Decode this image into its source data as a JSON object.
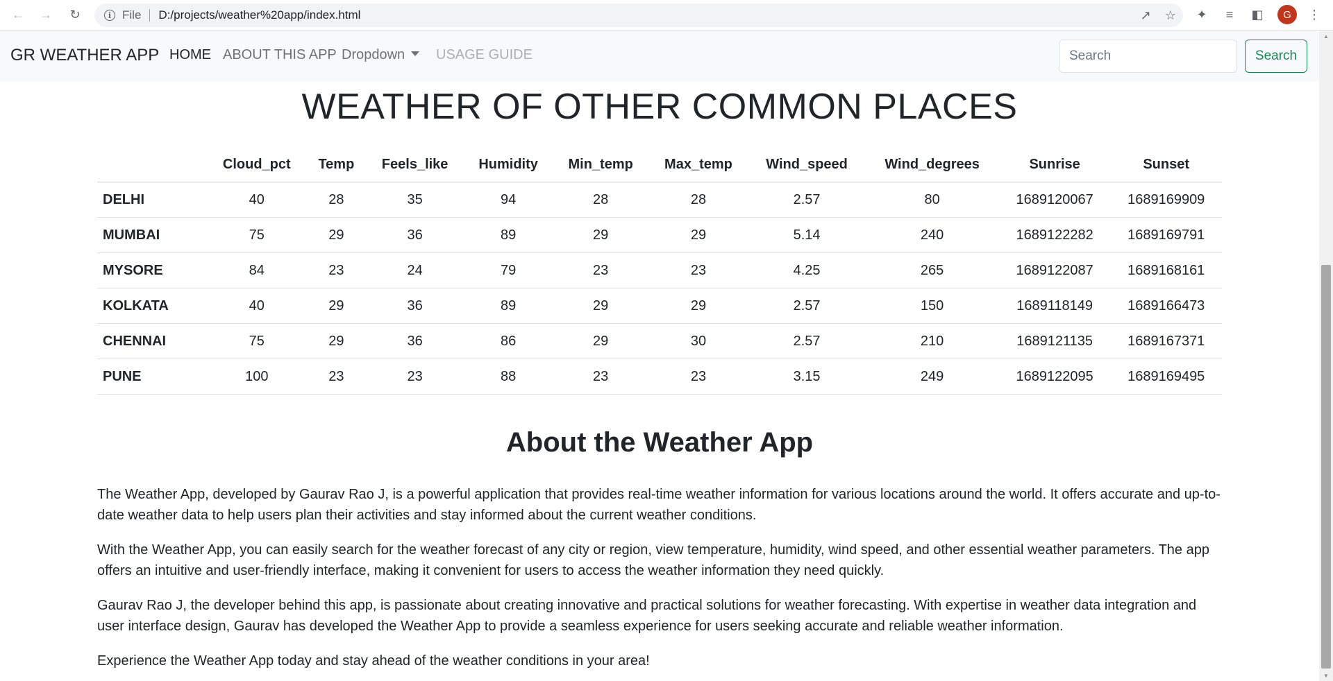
{
  "browser": {
    "scheme": "File",
    "url": "D:/projects/weather%20app/index.html",
    "profile_initial": "G",
    "profile_color": "#c1361b"
  },
  "navbar": {
    "brand": "GR WEATHER APP",
    "links": [
      "HOME",
      "ABOUT THIS APP",
      "Dropdown",
      "USAGE GUIDE"
    ],
    "search_placeholder": "Search",
    "search_button": "Search",
    "accent": "#198754"
  },
  "weather": {
    "title": "WEATHER OF OTHER COMMON PLACES",
    "columns": [
      "",
      "Cloud_pct",
      "Temp",
      "Feels_like",
      "Humidity",
      "Min_temp",
      "Max_temp",
      "Wind_speed",
      "Wind_degrees",
      "Sunrise",
      "Sunset"
    ],
    "rows": [
      [
        "DELHI",
        "40",
        "28",
        "35",
        "94",
        "28",
        "28",
        "2.57",
        "80",
        "1689120067",
        "1689169909"
      ],
      [
        "MUMBAI",
        "75",
        "29",
        "36",
        "89",
        "29",
        "29",
        "5.14",
        "240",
        "1689122282",
        "1689169791"
      ],
      [
        "MYSORE",
        "84",
        "23",
        "24",
        "79",
        "23",
        "23",
        "4.25",
        "265",
        "1689122087",
        "1689168161"
      ],
      [
        "KOLKATA",
        "40",
        "29",
        "36",
        "89",
        "29",
        "29",
        "2.57",
        "150",
        "1689118149",
        "1689166473"
      ],
      [
        "CHENNAI",
        "75",
        "29",
        "36",
        "86",
        "29",
        "30",
        "2.57",
        "210",
        "1689121135",
        "1689167371"
      ],
      [
        "PUNE",
        "100",
        "23",
        "23",
        "88",
        "23",
        "23",
        "3.15",
        "249",
        "1689122095",
        "1689169495"
      ]
    ]
  },
  "about": {
    "title": "About the Weather App",
    "paragraphs": [
      "The Weather App, developed by Gaurav Rao J, is a powerful application that provides real-time weather information for various locations around the world. It offers accurate and up-to-date weather data to help users plan their activities and stay informed about the current weather conditions.",
      "With the Weather App, you can easily search for the weather forecast of any city or region, view temperature, humidity, wind speed, and other essential weather parameters. The app offers an intuitive and user-friendly interface, making it convenient for users to access the weather information they need quickly.",
      "Gaurav Rao J, the developer behind this app, is passionate about creating innovative and practical solutions for weather forecasting. With expertise in weather data integration and user interface design, Gaurav has developed the Weather App to provide a seamless experience for users seeking accurate and reliable weather information.",
      "Experience the Weather App today and stay ahead of the weather conditions in your area!"
    ]
  }
}
